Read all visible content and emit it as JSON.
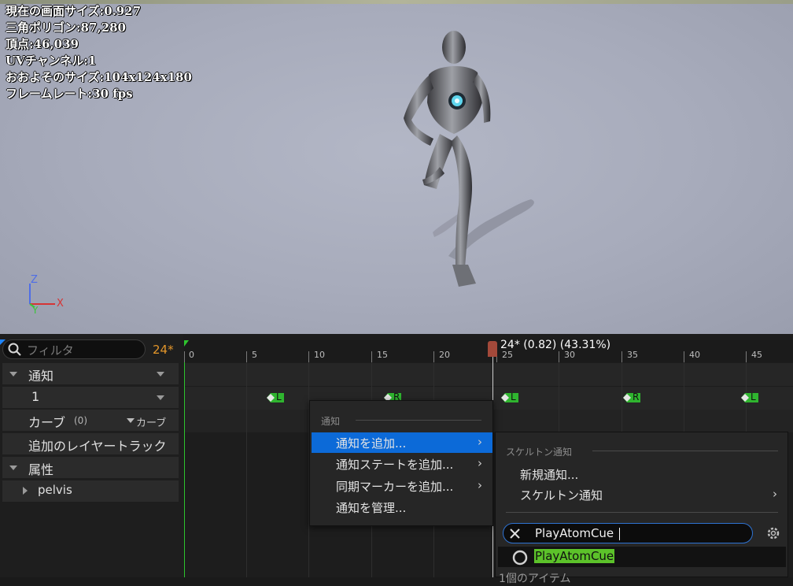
{
  "viewport": {
    "stats": [
      "現在の画面サイズ:0.927",
      "三角ポリゴン:87,280",
      "頂点:46,039",
      "UVチャンネル:1",
      "おおよそのサイズ:104x124x180",
      "フレームレート:30 fps"
    ],
    "axis": {
      "z": "Z",
      "y": "Y",
      "x": "X"
    }
  },
  "left_panel": {
    "filter_placeholder": "フィルタ",
    "frame_indicator": "24*",
    "rows": {
      "notify": "通知",
      "notify_track": "1",
      "curves": "カーブ",
      "curves_count": "(0)",
      "curves_menu": "カーブ",
      "additive_layer": "追加のレイヤートラック",
      "attributes": "属性",
      "pelvis": "pelvis"
    }
  },
  "timeline": {
    "ticks": [
      "0",
      "5",
      "10",
      "15",
      "20",
      "25",
      "30",
      "35",
      "40",
      "45"
    ],
    "playhead_label": "24* (0.82) (43.31%)",
    "markers": [
      "L",
      "R",
      "L",
      "R",
      "L"
    ]
  },
  "context_menu": {
    "header": "通知",
    "items": [
      "通知を追加...",
      "通知ステートを追加...",
      "同期マーカーを追加...",
      "通知を管理..."
    ]
  },
  "submenu": {
    "header": "スケルトン通知",
    "new_notify": "新規通知...",
    "skeleton_notify": "スケルトン通知",
    "search_value": "PlayAtomCue",
    "result": "PlayAtomCue",
    "count_text": "1個のアイテム"
  },
  "colors": {
    "accent": "#0c6ad8",
    "marker": "#2fb52f",
    "highlight": "#5cc22a",
    "playhead": "#a3493a"
  }
}
